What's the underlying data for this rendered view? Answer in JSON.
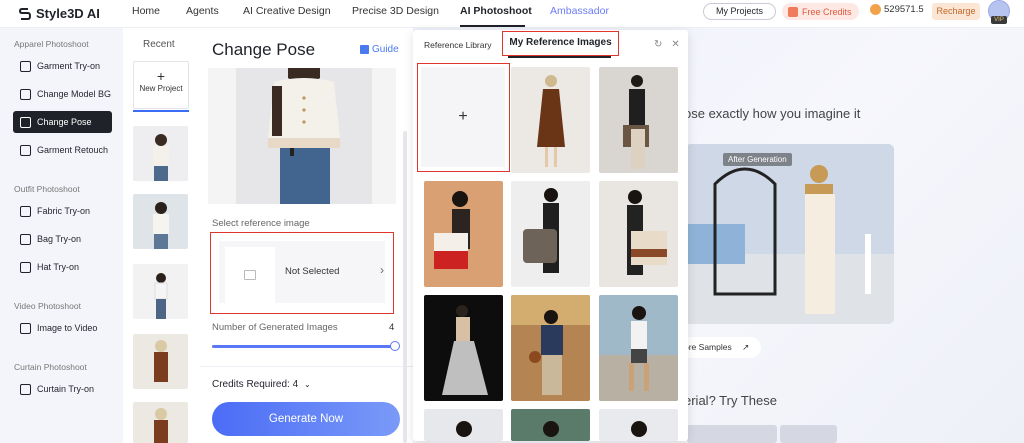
{
  "brand": {
    "name": "Style3D AI"
  },
  "nav": {
    "items": [
      {
        "label": "Home"
      },
      {
        "label": "Agents"
      },
      {
        "label": "AI Creative Design"
      },
      {
        "label": "Precise 3D Design"
      },
      {
        "label": "AI Photoshoot"
      },
      {
        "label": "Ambassador"
      }
    ],
    "active": "AI Photoshoot"
  },
  "header": {
    "my_projects": "My Projects",
    "free_credits": "Free Credits",
    "balance": "529571.5",
    "recharge": "Recharge",
    "vip": "VIP"
  },
  "sidebar": {
    "sections": [
      {
        "title": "Apparel Photoshoot",
        "items": [
          "Garment Try-on",
          "Change Model BG",
          "Change Pose",
          "Garment Retouch"
        ]
      },
      {
        "title": "Outfit Photoshoot",
        "items": [
          "Fabric Try-on",
          "Bag Try-on",
          "Hat Try-on"
        ]
      },
      {
        "title": "Video Photoshoot",
        "items": [
          "Image to Video"
        ]
      },
      {
        "title": "Curtain Photoshoot",
        "items": [
          "Curtain Try-on"
        ]
      }
    ],
    "active": "Change Pose"
  },
  "recent": {
    "title": "Recent",
    "new_project": "New Project"
  },
  "form": {
    "title": "Change Pose",
    "guide": "Guide",
    "select_ref_label": "Select reference image",
    "not_selected": "Not Selected",
    "num_images_label": "Number of Generated Images",
    "num_images_value": "4",
    "num_images_fraction": 1.0,
    "credits_required": "Credits Required: 4",
    "generate": "Generate Now"
  },
  "popup": {
    "tab_library": "Reference Library",
    "tab_mine": "My Reference Images",
    "add_symbol": "+"
  },
  "background": {
    "tagline": "ose exactly how you imagine it",
    "after_badge": "After Generation",
    "more_samples": "ore Samples",
    "try_these": "erial? Try These"
  },
  "colors": {
    "accent": "#4b6cf6",
    "highlight": "#e0352b",
    "active_nav": "#1f2329"
  }
}
